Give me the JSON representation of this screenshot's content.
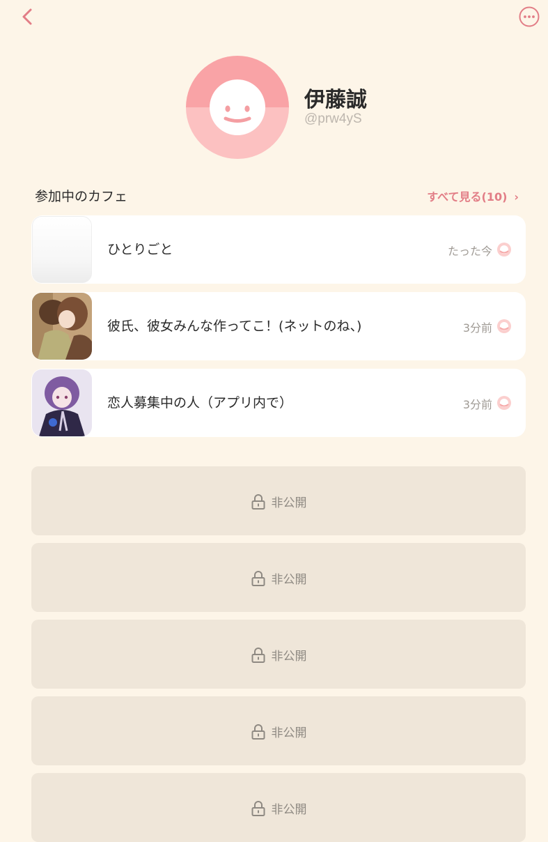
{
  "user": {
    "name": "伊藤誠",
    "handle": "@prw4yS"
  },
  "cafes_section": {
    "title": "参加中のカフェ",
    "see_all": "すべて見る(10)",
    "items": [
      {
        "title": "ひとりごと",
        "time": "たった今"
      },
      {
        "title": "彼氏、彼女みんな作ってこ！(ネットのね、)",
        "time": "3分前"
      },
      {
        "title": "恋人募集中の人（アプリ内で）",
        "time": "3分前"
      }
    ]
  },
  "private_items": [
    {
      "label": "非公開"
    },
    {
      "label": "非公開"
    },
    {
      "label": "非公開"
    },
    {
      "label": "非公開"
    },
    {
      "label": "非公開"
    }
  ],
  "icons": {
    "back": "chevron-left-icon",
    "more": "more-icon",
    "lock": "lock-icon",
    "status": "status-dot-icon"
  },
  "colors": {
    "background": "#fdf5e8",
    "accent": "#e27d86",
    "card": "#ffffff",
    "private_card": "#efe6d9"
  }
}
